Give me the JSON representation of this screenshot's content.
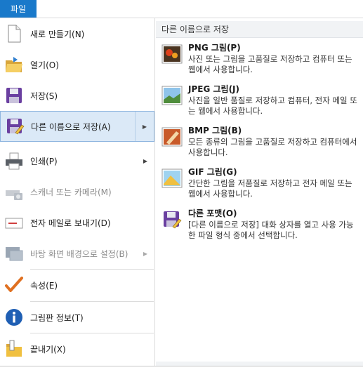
{
  "file_tab": {
    "label": "파일"
  },
  "menu": {
    "items": [
      {
        "label": "새로 만들기(N)",
        "icon": "new-document-icon"
      },
      {
        "label": "열기(O)",
        "icon": "open-folder-icon"
      },
      {
        "label": "저장(S)",
        "icon": "save-floppy-icon"
      },
      {
        "label": "다른 이름으로 저장(A)",
        "icon": "save-as-icon",
        "selected": true,
        "submenu": true
      },
      {
        "label": "인쇄(P)",
        "icon": "printer-icon",
        "submenu": true
      },
      {
        "label": "스캐너 또는 카메라(M)",
        "icon": "scanner-camera-icon",
        "disabled": true
      },
      {
        "label": "전자 메일로 보내기(D)",
        "icon": "email-envelope-icon"
      },
      {
        "label": "바탕 화면 배경으로 설정(B)",
        "icon": "desktop-background-icon",
        "disabled": true,
        "submenu": true
      },
      {
        "label": "속성(E)",
        "icon": "checkmark-icon"
      },
      {
        "label": "그림판 정보(T)",
        "icon": "info-icon"
      },
      {
        "label": "끝내기(X)",
        "icon": "exit-icon"
      }
    ]
  },
  "save_as_panel": {
    "title": "다른 이름으로 저장",
    "options": [
      {
        "title": "PNG 그림(P)",
        "desc": "사진 또는 그림을 고품질로 저장하고 컴퓨터 또는 웹에서 사용합니다.",
        "icon": "png-picture-icon"
      },
      {
        "title": "JPEG 그림(J)",
        "desc": "사진을 일반 품질로 저장하고 컴퓨터, 전자 메일 또는 웹에서 사용합니다.",
        "icon": "jpeg-picture-icon"
      },
      {
        "title": "BMP 그림(B)",
        "desc": "모든 종류의 그림을 고품질로 저장하고 컴퓨터에서 사용합니다.",
        "icon": "bmp-picture-icon"
      },
      {
        "title": "GIF 그림(G)",
        "desc": "간단한 그림을 저품질로 저장하고 전자 메일 또는 웹에서 사용합니다.",
        "icon": "gif-picture-icon"
      },
      {
        "title": "다른 포맷(O)",
        "desc": "[다른 이름으로 저장] 대화 상자를 열고 사용 가능한 파일 형식 중에서 선택합니다.",
        "icon": "other-formats-icon"
      }
    ]
  },
  "colors": {
    "file_tab": "#1979ca",
    "selected_bg": "#dbe9f7",
    "selected_border": "#8fb6e0"
  }
}
